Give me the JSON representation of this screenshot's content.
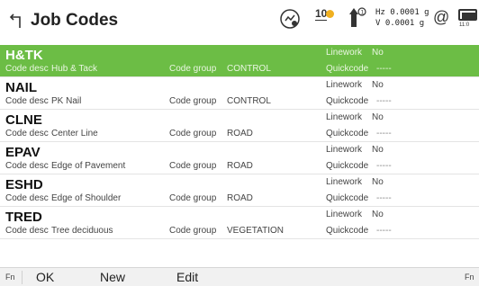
{
  "header": {
    "title": "Job Codes",
    "satellites": "10",
    "precision_h": "Hz 0.0001 g",
    "precision_v": "V  0.0001 g",
    "at_symbol": "@",
    "battery_time": "11:0"
  },
  "labels": {
    "code_desc": "Code desc",
    "code_group": "Code group",
    "linework": "Linework",
    "quickcode": "Quickcode"
  },
  "rows": [
    {
      "code": "H&TK",
      "desc": "Hub & Tack",
      "group": "CONTROL",
      "linework": "No",
      "quickcode": "-----"
    },
    {
      "code": "NAIL",
      "desc": "PK Nail",
      "group": "CONTROL",
      "linework": "No",
      "quickcode": "-----"
    },
    {
      "code": "CLNE",
      "desc": "Center Line",
      "group": "ROAD",
      "linework": "No",
      "quickcode": "-----"
    },
    {
      "code": "EPAV",
      "desc": "Edge of Pavement",
      "group": "ROAD",
      "linework": "No",
      "quickcode": "-----"
    },
    {
      "code": "ESHD",
      "desc": "Edge of Shoulder",
      "group": "ROAD",
      "linework": "No",
      "quickcode": "-----"
    },
    {
      "code": "TRED",
      "desc": "Tree deciduous",
      "group": "VEGETATION",
      "linework": "No",
      "quickcode": "-----"
    }
  ],
  "softkeys": {
    "fn_left": "Fn",
    "ok": "OK",
    "new": "New",
    "edit": "Edit",
    "fn_right": "Fn"
  },
  "colors": {
    "selected_row": "#6cbd45",
    "sat_indicator": "#f0b020"
  }
}
